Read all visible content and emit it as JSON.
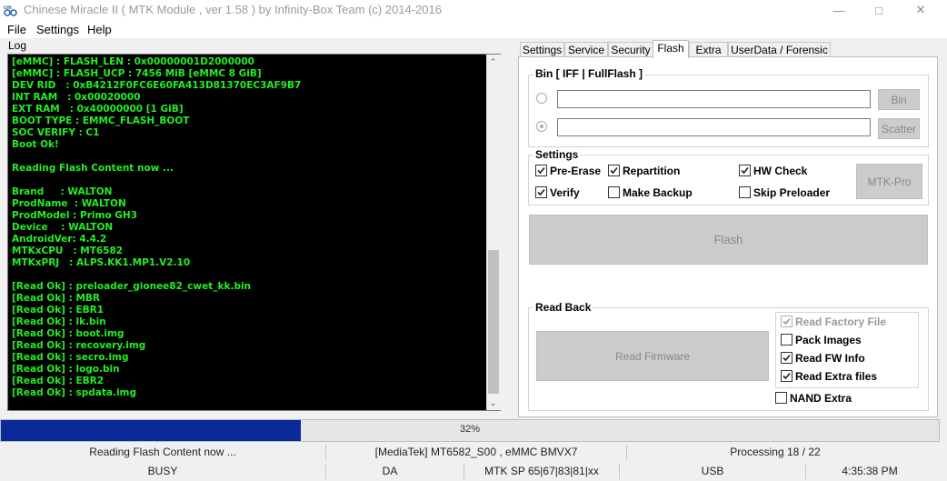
{
  "window": {
    "title": "Chinese Miracle II ( MTK Module , ver 1.58 ) by Infinity-Box Team (c) 2014-2016"
  },
  "menu": {
    "items": [
      "File",
      "Settings",
      "Help"
    ]
  },
  "log": {
    "label": "Log",
    "lines": [
      "[eMMC] : FLASH_LEN : 0x00000001D2000000",
      "[eMMC] : FLASH_UCP : 7456 MiB [eMMC 8 GiB]",
      "DEV RID   : 0xB4212F0FC6E60FA413D81370EC3AF9B7",
      "INT RAM   : 0x00020000",
      "EXT RAM   : 0x40000000 [1 GiB]",
      "BOOT TYPE : EMMC_FLASH_BOOT",
      "SOC VERIFY : C1",
      "Boot Ok!",
      "",
      "Reading Flash Content now ...",
      "",
      "Brand     : WALTON",
      "ProdName  : WALTON",
      "ProdModel : Primo GH3",
      "Device    : WALTON",
      "AndroidVer: 4.4.2",
      "MTKxCPU   : MT6582",
      "MTKxPRJ   : ALPS.KK1.MP1.V2.10",
      "",
      "[Read Ok] : preloader_gionee82_cwet_kk.bin",
      "[Read Ok] : MBR",
      "[Read Ok] : EBR1",
      "[Read Ok] : lk.bin",
      "[Read Ok] : boot.img",
      "[Read Ok] : recovery.img",
      "[Read Ok] : secro.img",
      "[Read Ok] : logo.bin",
      "[Read Ok] : EBR2",
      "[Read Ok] : spdata.img"
    ],
    "text_color": "#22ee22",
    "background": "#000000"
  },
  "tabs": {
    "items": [
      "Settings",
      "Service",
      "Security",
      "Flash",
      "Extra",
      "UserData / Forensic"
    ],
    "active": "Flash"
  },
  "flash": {
    "bin_group": {
      "title": "Bin  [ IFF | FullFlash ]",
      "bin_button": "Bin",
      "scatter_button": "Scatter",
      "bin_path": "",
      "scatter_path": ""
    },
    "settings_group": {
      "title": "Settings",
      "pre_erase": {
        "label": "Pre-Erase",
        "checked": true
      },
      "repartition": {
        "label": "Repartition",
        "checked": true
      },
      "hw_check": {
        "label": "HW Check",
        "checked": true
      },
      "verify": {
        "label": "Verify",
        "checked": true
      },
      "make_backup": {
        "label": "Make Backup",
        "checked": false
      },
      "skip_preloader": {
        "label": "Skip Preloader",
        "checked": false
      },
      "mtk_pro_button": "MTK-Pro"
    },
    "flash_button": "Flash",
    "readback_group": {
      "title": "Read Back",
      "read_firmware_button": "Read Firmware",
      "read_factory_file": {
        "label": "Read Factory File",
        "checked": true,
        "enabled": false
      },
      "pack_images": {
        "label": "Pack Images",
        "checked": false
      },
      "read_fw_info": {
        "label": "Read FW Info",
        "checked": true
      },
      "read_extra_files": {
        "label": "Read Extra files",
        "checked": true
      },
      "nand_extra": {
        "label": "NAND Extra",
        "checked": false
      }
    }
  },
  "progress": {
    "value": 0.32,
    "label": "32%",
    "color": "#0a2a9a"
  },
  "status1": {
    "message": "Reading Flash Content now ...",
    "chip": "[MediaTek] MT6582_S00 , eMMC BMVX7",
    "processing": "Processing 18 / 22"
  },
  "status2": {
    "state": "BUSY",
    "mode": "DA",
    "sp": "MTK SP 65|67|83|81|xx",
    "port": "USB",
    "time": "4:35:38 PM"
  }
}
